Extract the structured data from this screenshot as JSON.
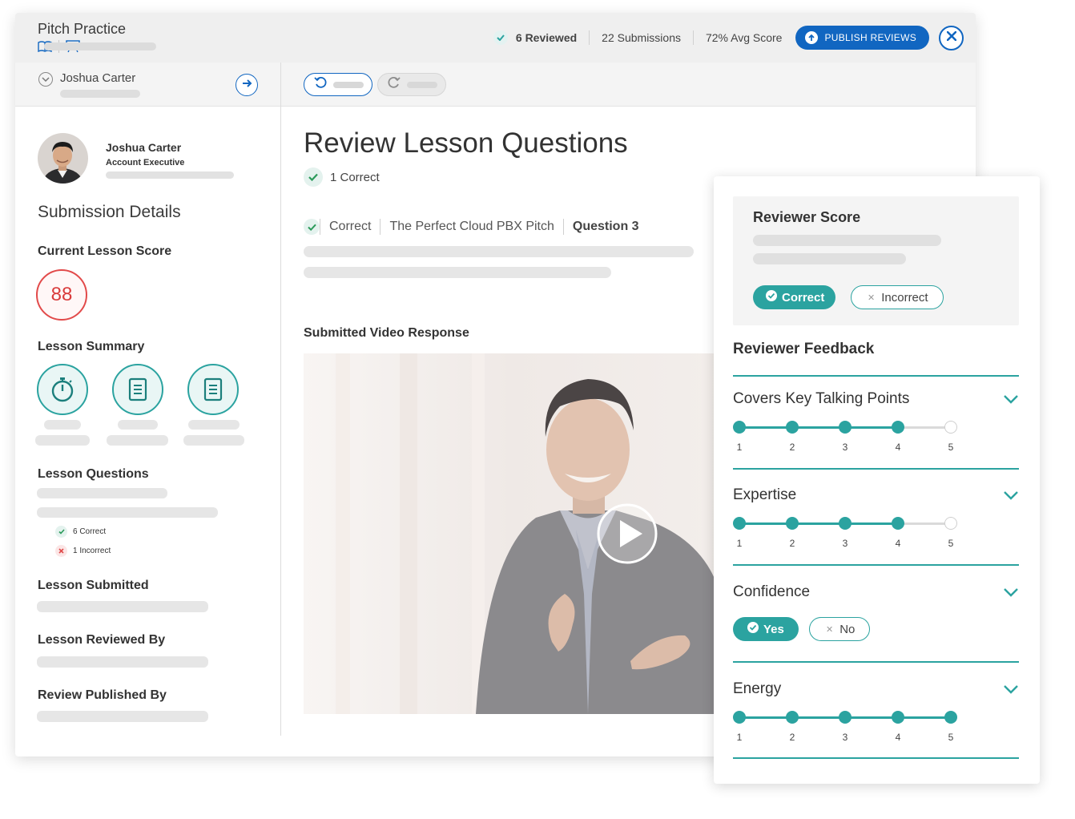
{
  "header": {
    "title": "Pitch Practice",
    "reviewed": "6 Reviewed",
    "submissions": "22 Submissions",
    "avg_score": "72% Avg Score",
    "publish_label": "PUBLISH REVIEWS"
  },
  "left_panel": {
    "selector_name": "Joshua Carter",
    "profile": {
      "name": "Joshua Carter",
      "role": "Account Executive"
    },
    "submission_details_title": "Submission Details",
    "current_score_label": "Current Lesson Score",
    "current_score": "88",
    "lesson_summary_label": "Lesson Summary",
    "summary_icons": [
      "stopwatch-icon",
      "document-icon",
      "document-icon"
    ],
    "lesson_questions_label": "Lesson Questions",
    "correct_line": "6 Correct",
    "incorrect_line": "1 Incorrect",
    "lesson_submitted_label": "Lesson Submitted",
    "reviewed_by_label": "Lesson Reviewed By",
    "published_by_label": "Review Published By"
  },
  "main": {
    "title": "Review Lesson Questions",
    "correct_count": "1 Correct",
    "question_status": "Correct",
    "question_lesson": "The Perfect Cloud PBX Pitch",
    "question_number": "Question 3",
    "video_label": "Submitted Video Response"
  },
  "review_panel": {
    "score_title": "Reviewer Score",
    "correct_label": "Correct",
    "incorrect_label": "Incorrect",
    "selected": "Correct",
    "feedback_title": "Reviewer Feedback",
    "criteria": [
      {
        "name": "Covers Key Talking Points",
        "type": "rating",
        "value": 4,
        "max": 5
      },
      {
        "name": "Expertise",
        "type": "rating",
        "value": 4,
        "max": 5
      },
      {
        "name": "Confidence",
        "type": "yesno",
        "yes_label": "Yes",
        "no_label": "No",
        "selected": "Yes"
      },
      {
        "name": "Energy",
        "type": "rating",
        "value": 5,
        "max": 5
      }
    ],
    "scale": [
      "1",
      "2",
      "3",
      "4",
      "5"
    ]
  },
  "colors": {
    "accent": "#2ba3a0",
    "primary": "#1166c1",
    "score_ring": "#e24a4a"
  }
}
